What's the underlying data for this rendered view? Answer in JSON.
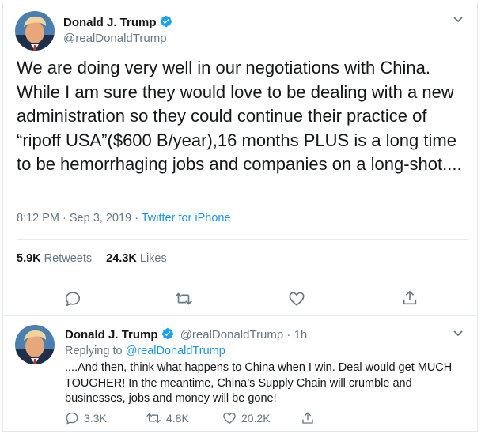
{
  "main_tweet": {
    "author_name": "Donald J. Trump",
    "author_handle": "@realDonaldTrump",
    "text": "We are doing very well in our negotiations with China. While I am sure they would love to be dealing with a new administration so they could continue their practice of “ripoff USA”($600 B/year),16 months PLUS is a long time to be hemorrhaging jobs and companies on a long-shot....",
    "time": "8:12 PM · Sep 3, 2019 · ",
    "source": "Twitter for iPhone",
    "retweets_count": "5.9K",
    "retweets_label": " Retweets",
    "likes_count": "24.3K",
    "likes_label": " Likes",
    "icons": [
      "reply-icon",
      "retweet-icon",
      "like-icon",
      "share-icon"
    ]
  },
  "reply_tweet": {
    "author_name": "Donald J. Trump",
    "author_handle": "@realDonaldTrump · 1h",
    "replying_prefix": "Replying to ",
    "replying_to": "@realDonaldTrump",
    "text": "....And then, think what happens to China when I win. Deal would get MUCH TOUGHER! In the meantime, China’s Supply Chain will crumble and businesses, jobs and money will be gone!",
    "reply_count": "3.3K",
    "retweet_count": "4.8K",
    "like_count": "20.2K"
  },
  "colors": {
    "accent": "#1b95e0",
    "text": "#14171a",
    "muted": "#657786",
    "border": "#e6ecf0"
  }
}
